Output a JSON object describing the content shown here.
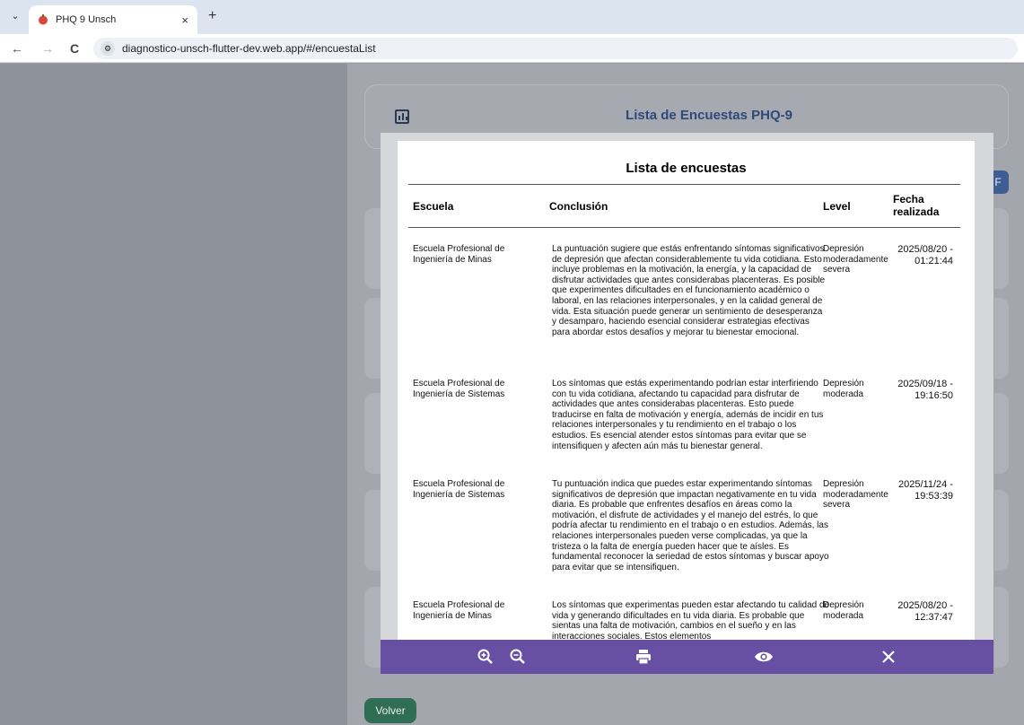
{
  "browser": {
    "tab_title": "PHQ 9 Unsch",
    "tab_close": "×",
    "new_tab": "+",
    "url": "diagnostico-unsch-flutter-dev.web.app/#/encuestaList",
    "back": "←",
    "forward": "→",
    "reload": "C"
  },
  "app": {
    "header_title": "Lista de Encuestas PHQ-9",
    "fab_label": "F",
    "back_button": "Volver"
  },
  "preview": {
    "title": "Lista de encuestas",
    "columns": [
      "Escuela",
      "Conclusión",
      "Level",
      "Fecha realizada"
    ],
    "rows": [
      {
        "escuela": "Escuela Profesional de Ingeniería de Minas",
        "conclusion": "La puntuación sugiere que estás enfrentando síntomas significativos de depresión que afectan considerablemente tu vida cotidiana. Esto incluye problemas en la motivación, la energía, y la capacidad de disfrutar actividades que antes considerabas placenteras. Es posible que experimentes dificultades en el funcionamiento académico o laboral, en las relaciones interpersonales, y en la calidad general de vida. Esta situación puede generar un sentimiento de desesperanza y desamparo, haciendo esencial considerar estrategias efectivas para abordar estos desafíos y mejorar tu bienestar emocional.",
        "level": "Depresión moderadamente severa",
        "fecha": "2025/08/20 - 01:21:44"
      },
      {
        "escuela": "Escuela Profesional de Ingeniería de Sistemas",
        "conclusion": "Los síntomas que estás experimentando podrían estar interfiriendo con tu vida cotidiana, afectando tu capacidad para disfrutar de actividades que antes considerabas placenteras. Esto puede traducirse en falta de motivación y energía, además de incidir en tus relaciones interpersonales y tu rendimiento en el trabajo o los estudios. Es esencial atender estos síntomas para evitar que se intensifiquen y afecten aún más tu bienestar general.",
        "level": "Depresión moderada",
        "fecha": "2025/09/18 - 19:16:50"
      },
      {
        "escuela": "Escuela Profesional de Ingeniería de Sistemas",
        "conclusion": "Tu puntuación indica que puedes estar experimentando síntomas significativos de depresión que impactan negativamente en tu vida diaria. Es probable que enfrentes desafíos en áreas como la motivación, el disfrute de actividades y el manejo del estrés, lo que podría afectar tu rendimiento en el trabajo o en estudios. Además, las relaciones interpersonales pueden verse complicadas, ya que la tristeza o la falta de energía pueden hacer que te aísles. Es fundamental reconocer la seriedad de estos síntomas y buscar apoyo para evitar que se intensifiquen.",
        "level": "Depresión moderadamente severa",
        "fecha": "2025/11/24 - 19:53:39"
      },
      {
        "escuela": "Escuela Profesional de Ingeniería de Minas",
        "conclusion": "Los síntomas que experimentas pueden estar afectando tu calidad de vida y generando dificultades en tu vida diaria. Es probable que sientas una falta de motivación, cambios en el sueño y en las interacciones sociales. Estos elementos",
        "level": "Depresión moderada",
        "fecha": "2025/08/20 - 12:37:47"
      }
    ]
  },
  "toolbar": {
    "zoom_in": "zoom-in-icon",
    "zoom_out": "zoom-out-icon",
    "print": "print-icon",
    "preview": "eye-icon",
    "close": "close-icon"
  },
  "colors": {
    "toolbar": "#6750a4",
    "header_title": "#2d4a7a",
    "back_button": "#2f6e55"
  }
}
